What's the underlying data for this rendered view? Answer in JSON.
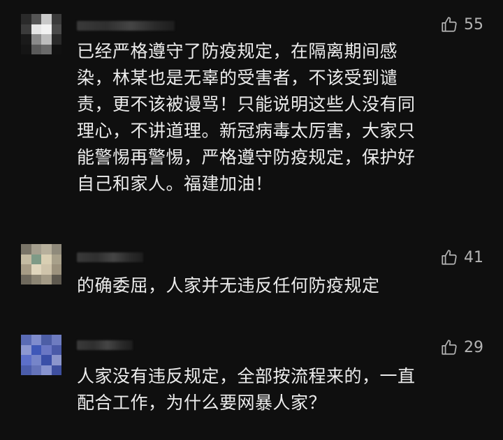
{
  "comments": [
    {
      "likes": "55",
      "text": "已经严格遵守了防疫规定，在隔离期间感\n染，林某也是无辜的受害者，不该受到谴\n责，更不该被谩骂！只能说明这些人没有同\n理心，不讲道理。新冠病毒太厉害，大家只\n能警惕再警惕，严格遵守防疫规定，保护好\n自己和家人。福建加油！"
    },
    {
      "likes": "41",
      "text": "的确委屈，人家并无违反任何防疫规定"
    },
    {
      "likes": "29",
      "text": "人家没有违反规定，全部按流程来的，一直\n配合工作，为什么要网暴人家？"
    }
  ],
  "icons": {
    "like": "thumbs-up-icon"
  },
  "colors": {
    "background": "#0f0f0f",
    "text": "#ececec",
    "like": "#b4b4b4"
  }
}
